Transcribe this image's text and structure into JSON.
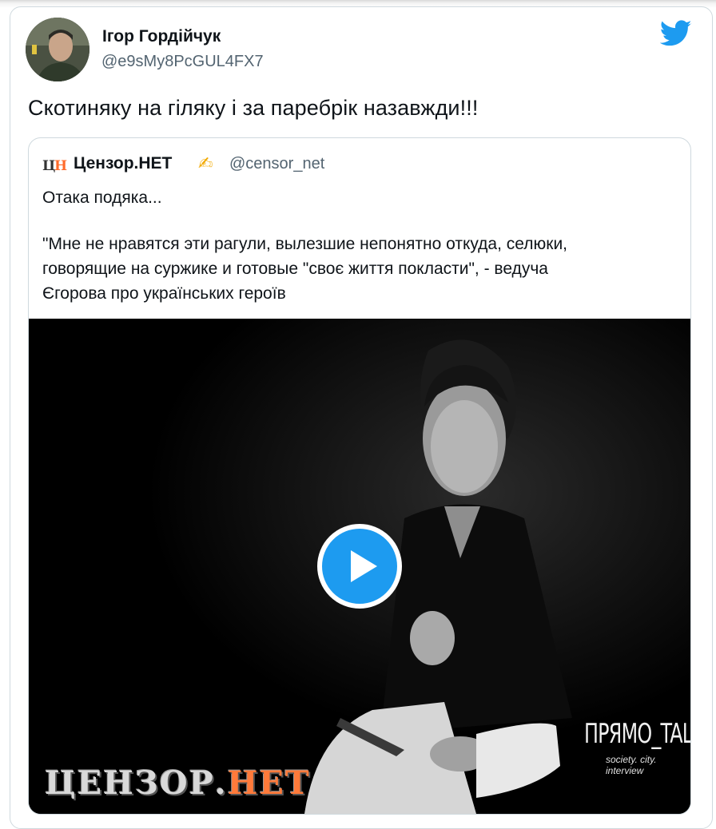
{
  "tweet": {
    "author_name": "Ігор Гордійчук",
    "author_handle": "@e9sMy8PcGUL4FX7",
    "text": "Скотиняку на гіляку і за паребрік назавжди!!!"
  },
  "quoted": {
    "logo_text": "ЦН",
    "name": "Цензор.НЕТ",
    "emoji": "✍",
    "handle": "@censor_net",
    "lines": [
      "Отака подяка...",
      "\"Мне не нравятся эти рагули, вылезшие непонятно откуда, селюки,",
      "говорящие на суржике и готовые \"своє життя покласти\", - ведуча",
      "Єгорова про українських героїв"
    ]
  },
  "media": {
    "watermark_left_main": "ЦЕНЗОР.",
    "watermark_left_accent": "НЕТ",
    "watermark_right": "ПРЯМО_TALK",
    "watermark_right_sub": "society. city. interview"
  },
  "icons": {
    "platform": "twitter-bird-icon",
    "play": "play-icon"
  },
  "colors": {
    "brand_blue": "#1d9bf0",
    "text_primary": "#0f1419",
    "text_secondary": "#536471",
    "logo_accent": "#ff7a3a"
  }
}
